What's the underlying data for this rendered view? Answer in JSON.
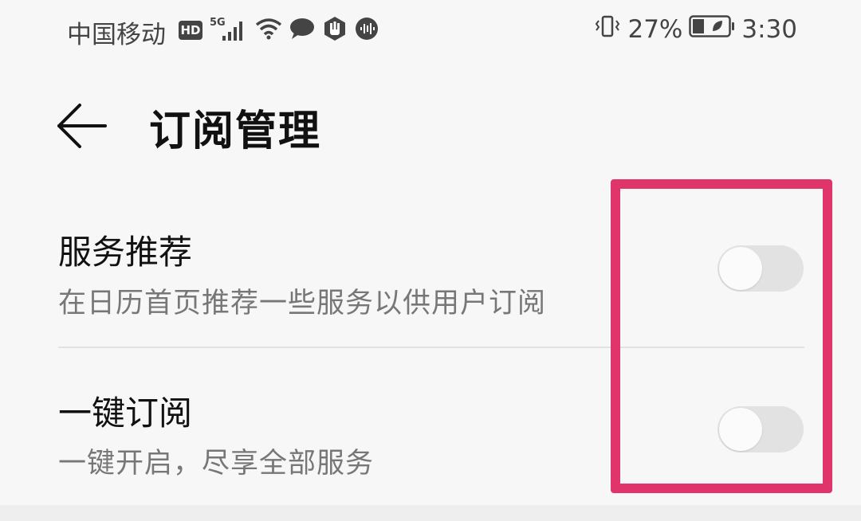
{
  "status_bar": {
    "carrier": "中国移动",
    "hd_badge": "HD",
    "network_type": "5G",
    "battery": "27%",
    "time": "3:30",
    "icons": [
      "hd-icon",
      "signal-icon",
      "wifi-icon",
      "message-icon",
      "hand-icon",
      "audio-icon",
      "vibrate-icon",
      "battery-icon"
    ]
  },
  "header": {
    "title": "订阅管理"
  },
  "settings": [
    {
      "title": "服务推荐",
      "subtitle": "在日历首页推荐一些服务以供用户订阅",
      "enabled": false
    },
    {
      "title": "一键订阅",
      "subtitle": "一键开启，尽享全部服务",
      "enabled": false
    }
  ],
  "colors": {
    "highlight": "#e0356b",
    "toggle_off": "#e2e2e2",
    "background": "#f7f7f7"
  }
}
